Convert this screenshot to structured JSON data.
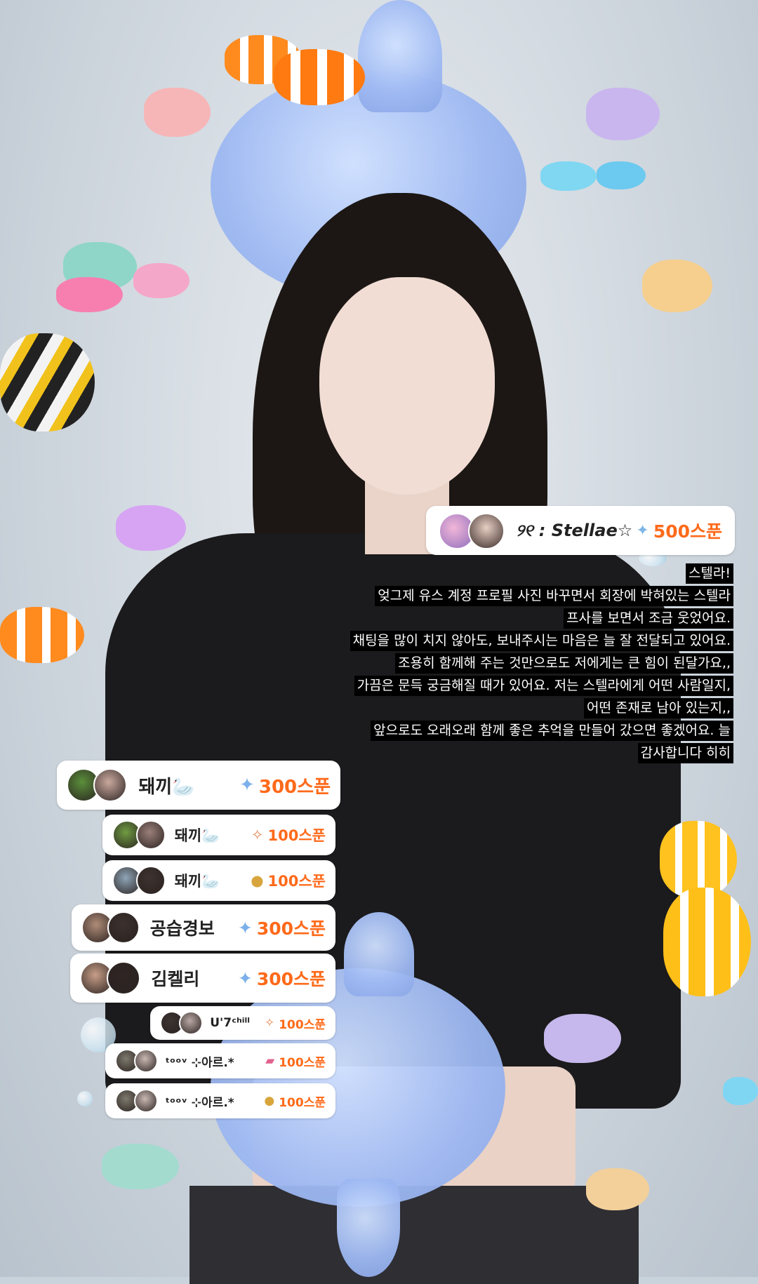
{
  "featured": {
    "name": "୨୧ : Stellae☆",
    "amount": "500스푼"
  },
  "message_lines": [
    "스텔라!",
    "엊그제 유스 계정 프로필 사진 바꾸면서 회장에 박혀있는 스텔라",
    "프사를 보면서 조금 웃었어요.",
    "채팅을 많이 치지 않아도, 보내주시는 마음은 늘 잘 전달되고 있어요.",
    "조용히 함께해 주는 것만으로도 저에게는 큰 힘이 된달가요,,",
    "가끔은 문득 궁금해질 때가 있어요.  저는 스텔라에게 어떤 사람일지,",
    "어떤 존재로 남아 있는지,,",
    "앞으로도 오래오래 함께 좋은 추억을 만들어 갔으면 좋겠어요. 늘",
    "감사합니다 히히"
  ],
  "donations": [
    {
      "name": "돼끼🦢",
      "amount": "300스푼",
      "icon": "ice-gift-icon"
    },
    {
      "name": "돼끼🦢",
      "amount": "100스푼",
      "icon": "candy-gift-icon"
    },
    {
      "name": "돼끼🦢",
      "amount": "100스푼",
      "icon": "pie-gift-icon"
    },
    {
      "name": "공습경보",
      "amount": "300스푼",
      "icon": "ice-gift-icon"
    },
    {
      "name": "김켈리",
      "amount": "300스푼",
      "icon": "ice-gift-icon"
    },
    {
      "name": "U'7ᶜʰⁱˡˡ",
      "amount": "100스푼",
      "icon": "candy-gift-icon"
    },
    {
      "name": "ᵗᵒᵒᵛ ⊹아르.*",
      "amount": "100스푼",
      "icon": "ticket-gift-icon"
    },
    {
      "name": "ᵗᵒᵒᵛ ⊹아르.*",
      "amount": "100스푼",
      "icon": "pie-gift-icon"
    }
  ],
  "colors": {
    "amount": "#ff6a1a",
    "card_bg": "#ffffff",
    "message_bg": "#000000",
    "message_text": "#ffffff"
  }
}
